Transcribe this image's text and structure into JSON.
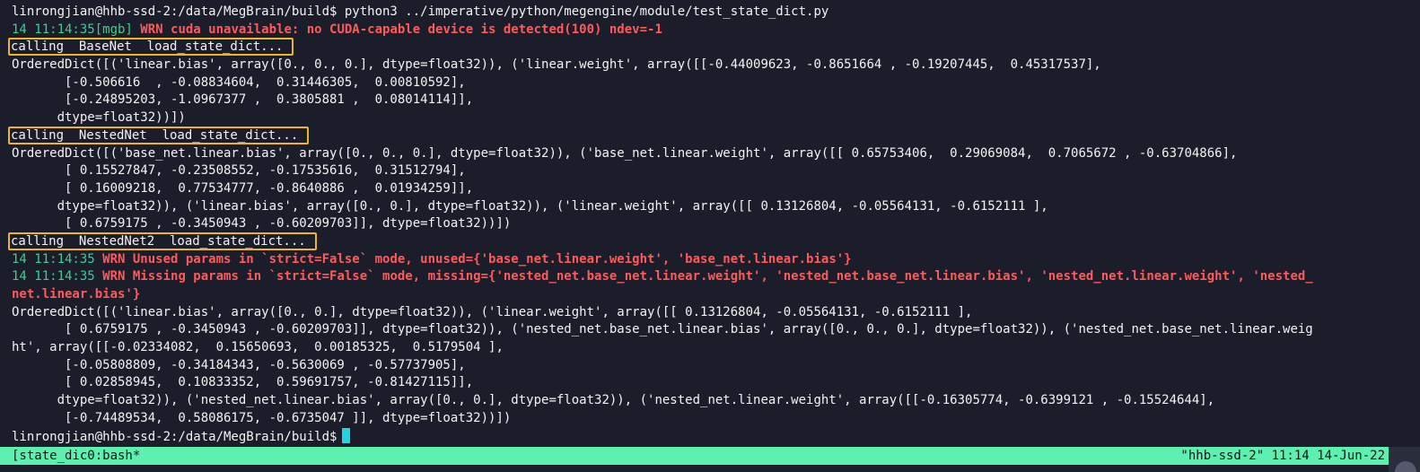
{
  "terminal": {
    "lines": [
      {
        "type": "plain",
        "text": "linrongjian@hhb-ssd-2:/data/MegBrain/build$ python3 ../imperative/python/megengine/module/test_state_dict.py"
      },
      {
        "type": "warn",
        "ts": "14 11:14:35[mgb] ",
        "text": "WRN cuda unavailable: no CUDA-capable device is detected(100) ndev=-1"
      },
      {
        "type": "highlight",
        "text": "calling  BaseNet  load_state_dict..."
      },
      {
        "type": "plain",
        "text": "OrderedDict([('linear.bias', array([0., 0., 0.], dtype=float32)), ('linear.weight', array([[-0.44009623, -0.8651664 , -0.19207445,  0.45317537],"
      },
      {
        "type": "plain",
        "text": "       [-0.506616  , -0.08834604,  0.31446305,  0.00810592],"
      },
      {
        "type": "plain",
        "text": "       [-0.24895203, -1.0967377 ,  0.3805881 ,  0.08014114]],"
      },
      {
        "type": "plain",
        "text": "      dtype=float32))])"
      },
      {
        "type": "highlight",
        "text": "calling  NestedNet  load_state_dict..."
      },
      {
        "type": "plain",
        "text": "OrderedDict([('base_net.linear.bias', array([0., 0., 0.], dtype=float32)), ('base_net.linear.weight', array([[ 0.65753406,  0.29069084,  0.7065672 , -0.63704866],"
      },
      {
        "type": "plain",
        "text": "       [ 0.15527847, -0.23508552, -0.17535616,  0.31512794],"
      },
      {
        "type": "plain",
        "text": "       [ 0.16009218,  0.77534777, -0.8640886 ,  0.01934259]],"
      },
      {
        "type": "plain",
        "text": "      dtype=float32)), ('linear.bias', array([0., 0.], dtype=float32)), ('linear.weight', array([[ 0.13126804, -0.05564131, -0.6152111 ],"
      },
      {
        "type": "plain",
        "text": "       [ 0.6759175 , -0.3450943 , -0.60209703]], dtype=float32))])"
      },
      {
        "type": "highlight",
        "text": "calling  NestedNet2  load_state_dict..."
      },
      {
        "type": "warn",
        "ts": "14 11:14:35 ",
        "text": "WRN Unused params in `strict=False` mode, unused={'base_net.linear.weight', 'base_net.linear.bias'}"
      },
      {
        "type": "warn",
        "ts": "14 11:14:35 ",
        "text": "WRN Missing params in `strict=False` mode, missing={'nested_net.base_net.linear.weight', 'nested_net.base_net.linear.bias', 'nested_net.linear.weight', 'nested_"
      },
      {
        "type": "warn",
        "ts": "",
        "text": "net.linear.bias'}"
      },
      {
        "type": "plain",
        "text": "OrderedDict([('linear.bias', array([0., 0.], dtype=float32)), ('linear.weight', array([[ 0.13126804, -0.05564131, -0.6152111 ],"
      },
      {
        "type": "plain",
        "text": "       [ 0.6759175 , -0.3450943 , -0.60209703]], dtype=float32)), ('nested_net.base_net.linear.bias', array([0., 0., 0.], dtype=float32)), ('nested_net.base_net.linear.weig"
      },
      {
        "type": "plain",
        "text": "ht', array([[-0.02334082,  0.15650693,  0.00185325,  0.5179504 ],"
      },
      {
        "type": "plain",
        "text": "       [-0.05808809, -0.34184343, -0.5630069 , -0.57737905],"
      },
      {
        "type": "plain",
        "text": "       [ 0.02858945,  0.10833352,  0.59691757, -0.81427115]],"
      },
      {
        "type": "plain",
        "text": "      dtype=float32)), ('nested_net.linear.bias', array([0., 0.], dtype=float32)), ('nested_net.linear.weight', array([[-0.16305774, -0.6399121 , -0.15524644],"
      },
      {
        "type": "plain",
        "text": "       [-0.74489534,  0.58086175, -0.6735047 ]], dtype=float32))])"
      },
      {
        "type": "prompt",
        "text": "linrongjian@hhb-ssd-2:/data/MegBrain/build$"
      }
    ]
  },
  "statusbar": {
    "left": "[state_dic0:bash*",
    "right": "\"hhb-ssd-2\" 11:14 14-Jun-22"
  },
  "colors": {
    "background": "#1b1d2a",
    "text": "#f3f3f3",
    "timestamp": "#3ccf8e",
    "warning": "#ff5a5a",
    "highlight_box": "#f0b429",
    "cursor": "#22d3e6",
    "statusbar": "#5ef0b0"
  }
}
